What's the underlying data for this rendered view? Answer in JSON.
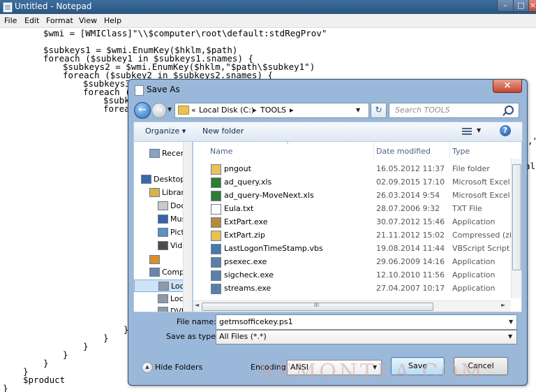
{
  "notepad": {
    "title": "Untitled - Notepad",
    "window_buttons": {
      "minimize": "–",
      "maximize": "□",
      "close": "×"
    },
    "menu": [
      "File",
      "Edit",
      "Format",
      "View",
      "Help"
    ],
    "code_lines": [
      "$wmi = [WMIClass]\"\\\\$computer\\root\\default:stdRegProv\"",
      "$subkeys1 = $wmi.EnumKey($hklm,$path)",
      "foreach ($subkey1 in $subkeys1.snames) {",
      "$subkeys2 = $wmi.EnumKey($hklm,\"$path\\$subkey1\")",
      "foreach ($subkey2 in $subkeys2.snames) {",
      "$subkeys3",
      "foreach (",
      "$subk",
      "forea",
      "}",
      "}",
      "}",
      "}",
      "}",
      "$product",
      "}",
      ",\"",
      "al"
    ]
  },
  "dialog": {
    "title": "Save As",
    "close_glyph": "×",
    "nav": {
      "back_glyph": "←",
      "forward_glyph": "→"
    },
    "address": {
      "crumbs": [
        "Local Disk (C:)",
        "TOOLS"
      ],
      "separator": "▸",
      "lead_separator": "«"
    },
    "refresh_glyph": "↻",
    "search_placeholder": "Search TOOLS",
    "toolbar": {
      "organize": "Organize ▾",
      "new_folder": "New folder",
      "help": "?"
    },
    "nav_pane": [
      {
        "label": "Recent",
        "icon": "recent-places-icon",
        "color": "#8aa2bf"
      },
      {
        "label": "Desktop",
        "icon": "desktop-icon",
        "color": "#3a6aa8"
      },
      {
        "label": "Libraries",
        "icon": "library-icon",
        "color": "#d9b24a"
      },
      {
        "label": "Documents",
        "icon": "documents-icon",
        "color": "#c9c9c9"
      },
      {
        "label": "Music",
        "icon": "music-icon",
        "color": "#3a62a8"
      },
      {
        "label": "Pictures",
        "icon": "pictures-icon",
        "color": "#5d8fbf"
      },
      {
        "label": "Videos",
        "icon": "videos-icon",
        "color": "#4c4c4c"
      },
      {
        "label": "",
        "icon": "homegroup-icon",
        "color": "#d98f2a"
      },
      {
        "label": "Computer",
        "icon": "computer-icon",
        "color": "#6a86a9"
      },
      {
        "label": "Local Disk (C:)",
        "icon": "local-disk-icon",
        "color": "#8f9aa6"
      },
      {
        "label": "Local Disk",
        "icon": "drive-icon",
        "color": "#8f9aa6"
      },
      {
        "label": "DVD",
        "icon": "dvd-drive-icon",
        "color": "#8f9aa6"
      }
    ],
    "columns": {
      "name": "Name",
      "date": "Date modified",
      "type": "Type"
    },
    "files": [
      {
        "name": "pngout",
        "date": "16.05.2012 11:37",
        "type": "File folder",
        "icon": "folder-icon",
        "color": "#e8c257"
      },
      {
        "name": "ad_query.xls",
        "date": "02.09.2015 17:10",
        "type": "Microsoft Excel 97",
        "icon": "excel-icon",
        "color": "#2e7d32"
      },
      {
        "name": "ad_query-MoveNext.xls",
        "date": "26.03.2014 9:54",
        "type": "Microsoft Excel 97",
        "icon": "excel-icon",
        "color": "#2e7d32"
      },
      {
        "name": "Eula.txt",
        "date": "28.07.2006 9:32",
        "type": "TXT File",
        "icon": "text-file-icon",
        "color": "#ffffff"
      },
      {
        "name": "ExtPart.exe",
        "date": "30.07.2012 15:46",
        "type": "Application",
        "icon": "installer-icon",
        "color": "#b68a3c"
      },
      {
        "name": "ExtPart.zip",
        "date": "21.11.2012 15:02",
        "type": "Compressed (zipp",
        "icon": "zip-folder-icon",
        "color": "#e8c257"
      },
      {
        "name": "LastLogonTimeStamp.vbs",
        "date": "19.08.2014 11:44",
        "type": "VBScript Script Fi",
        "icon": "script-icon",
        "color": "#4a78a8"
      },
      {
        "name": "psexec.exe",
        "date": "29.06.2009 14:16",
        "type": "Application",
        "icon": "application-icon",
        "color": "#5a7fa8"
      },
      {
        "name": "sigcheck.exe",
        "date": "12.10.2010 11:56",
        "type": "Application",
        "icon": "application-icon",
        "color": "#5a7fa8"
      },
      {
        "name": "streams.exe",
        "date": "27.04.2007 10:17",
        "type": "Application",
        "icon": "application-icon",
        "color": "#5a7fa8"
      }
    ],
    "file_name_label": "File name:",
    "file_name_value": "getmsofficekey.ps1",
    "save_as_type_label": "Save as type:",
    "save_as_type_value": "All Files (*.*)",
    "hide_folders": "Hide Folders",
    "encoding_label": "Encoding:",
    "encoding_value": "ANSI",
    "save": "Save",
    "cancel": "Cancel",
    "dropdown_glyph": "▼",
    "hscroll_left": "◄",
    "hscroll_right": "►",
    "hscroll_grip": "III",
    "sort_glyph": "˄"
  },
  "watermark": "REMONTKA.COM"
}
